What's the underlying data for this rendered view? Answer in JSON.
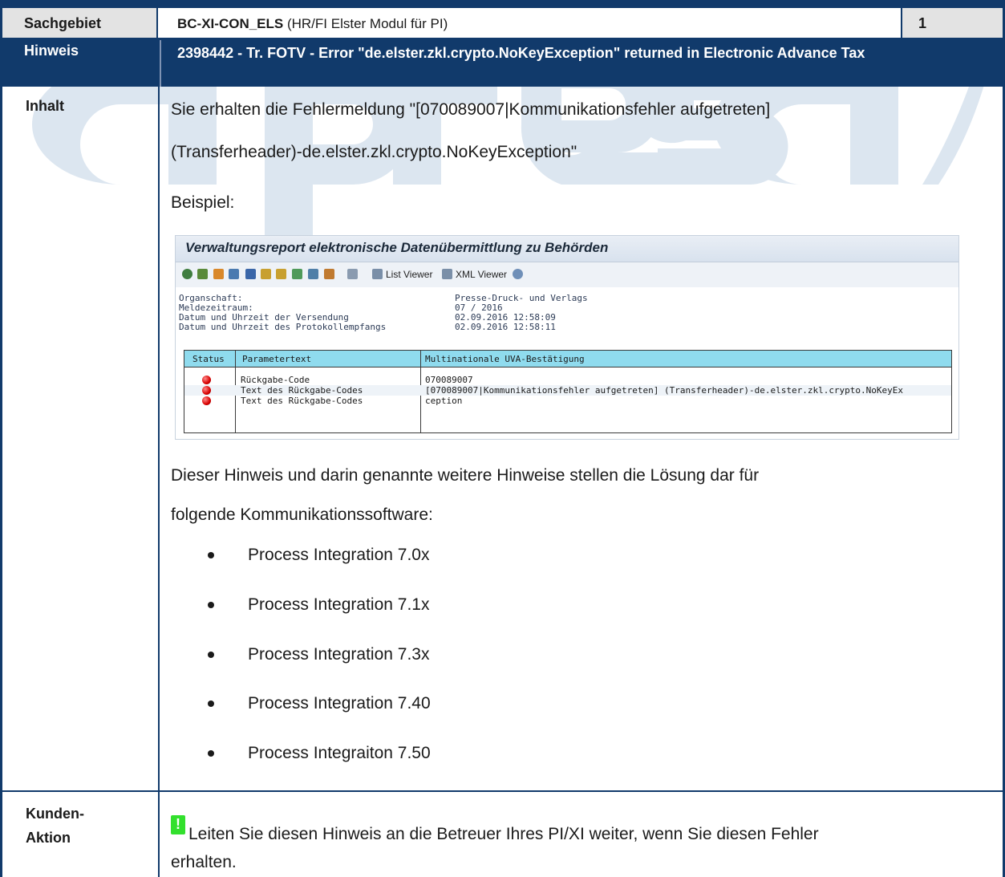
{
  "header": {
    "sachgebiet_label": "Sachgebiet",
    "sachgebiet_code": "BC-XI-CON_ELS",
    "sachgebiet_desc": "(HR/FI Elster Modul für PI)",
    "page_number": "1"
  },
  "hinweis": {
    "label": "Hinweis",
    "title": "2398442 - Tr. FOTV - Error \"de.elster.zkl.crypto.NoKeyException\" returned in Electronic Advance Tax"
  },
  "inhalt": {
    "label": "Inhalt",
    "intro_line1": "Sie erhalten die Fehlermeldung \"[070089007|Kommunikationsfehler aufgetreten]",
    "intro_line2": "(Transferheader)-de.elster.zkl.crypto.NoKeyException\"",
    "example_label": "Beispiel:",
    "after_line1": "Dieser Hinweis und darin genannte weitere Hinweise stellen die Lösung dar für",
    "after_line2": "folgende Kommunikationssoftware:",
    "software": [
      "Process Integration 7.0x",
      "Process Integration 7.1x",
      "Process Integration 7.3x",
      "Process Integration 7.40",
      "Process Integraiton 7.50"
    ]
  },
  "screenshot": {
    "title": "Verwaltungsreport elektronische Datenübermittlung zu Behörden",
    "toolbar": {
      "list_viewer": "List Viewer",
      "xml_viewer": "XML Viewer"
    },
    "info_labels": [
      "Organschaft:",
      "Meldezeitraum:",
      "Datum und Uhrzeit der Versendung",
      "Datum und Uhrzeit des Protokollempfangs"
    ],
    "info_values": [
      "Presse-Druck- und Verlags",
      "07 / 2016",
      "02.09.2016 12:58:09",
      "02.09.2016 12:58:11"
    ],
    "columns": [
      "Status",
      "Parametertext",
      "Multinationale UVA-Bestätigung"
    ],
    "rows": [
      {
        "param": "Rückgabe-Code",
        "value": "070089007"
      },
      {
        "param": "Text des Rückgabe-Codes",
        "value": "[070089007|Kommunikationsfehler aufgetreten] (Transferheader)-de.elster.zkl.crypto.NoKeyEx"
      },
      {
        "param": "Text des Rückgabe-Codes",
        "value": "ception"
      }
    ]
  },
  "kunden": {
    "label_line1": "Kunden-",
    "label_line2": "Aktion",
    "text_line1": "Leiten Sie diesen Hinweis an die Betreuer Ihres PI/XI weiter, wenn Sie diesen Fehler",
    "text_line2": "erhalten."
  },
  "colors": {
    "frame": "#113a6b",
    "header_gray": "#e3e3e3",
    "watermark": "#dce6f0",
    "grid_header": "#8fdbee",
    "status_red": "#d80000",
    "action_green": "#33e02d"
  },
  "icons": [
    "exclamation-icon",
    "red-light-icon",
    "toolbar-icons"
  ]
}
